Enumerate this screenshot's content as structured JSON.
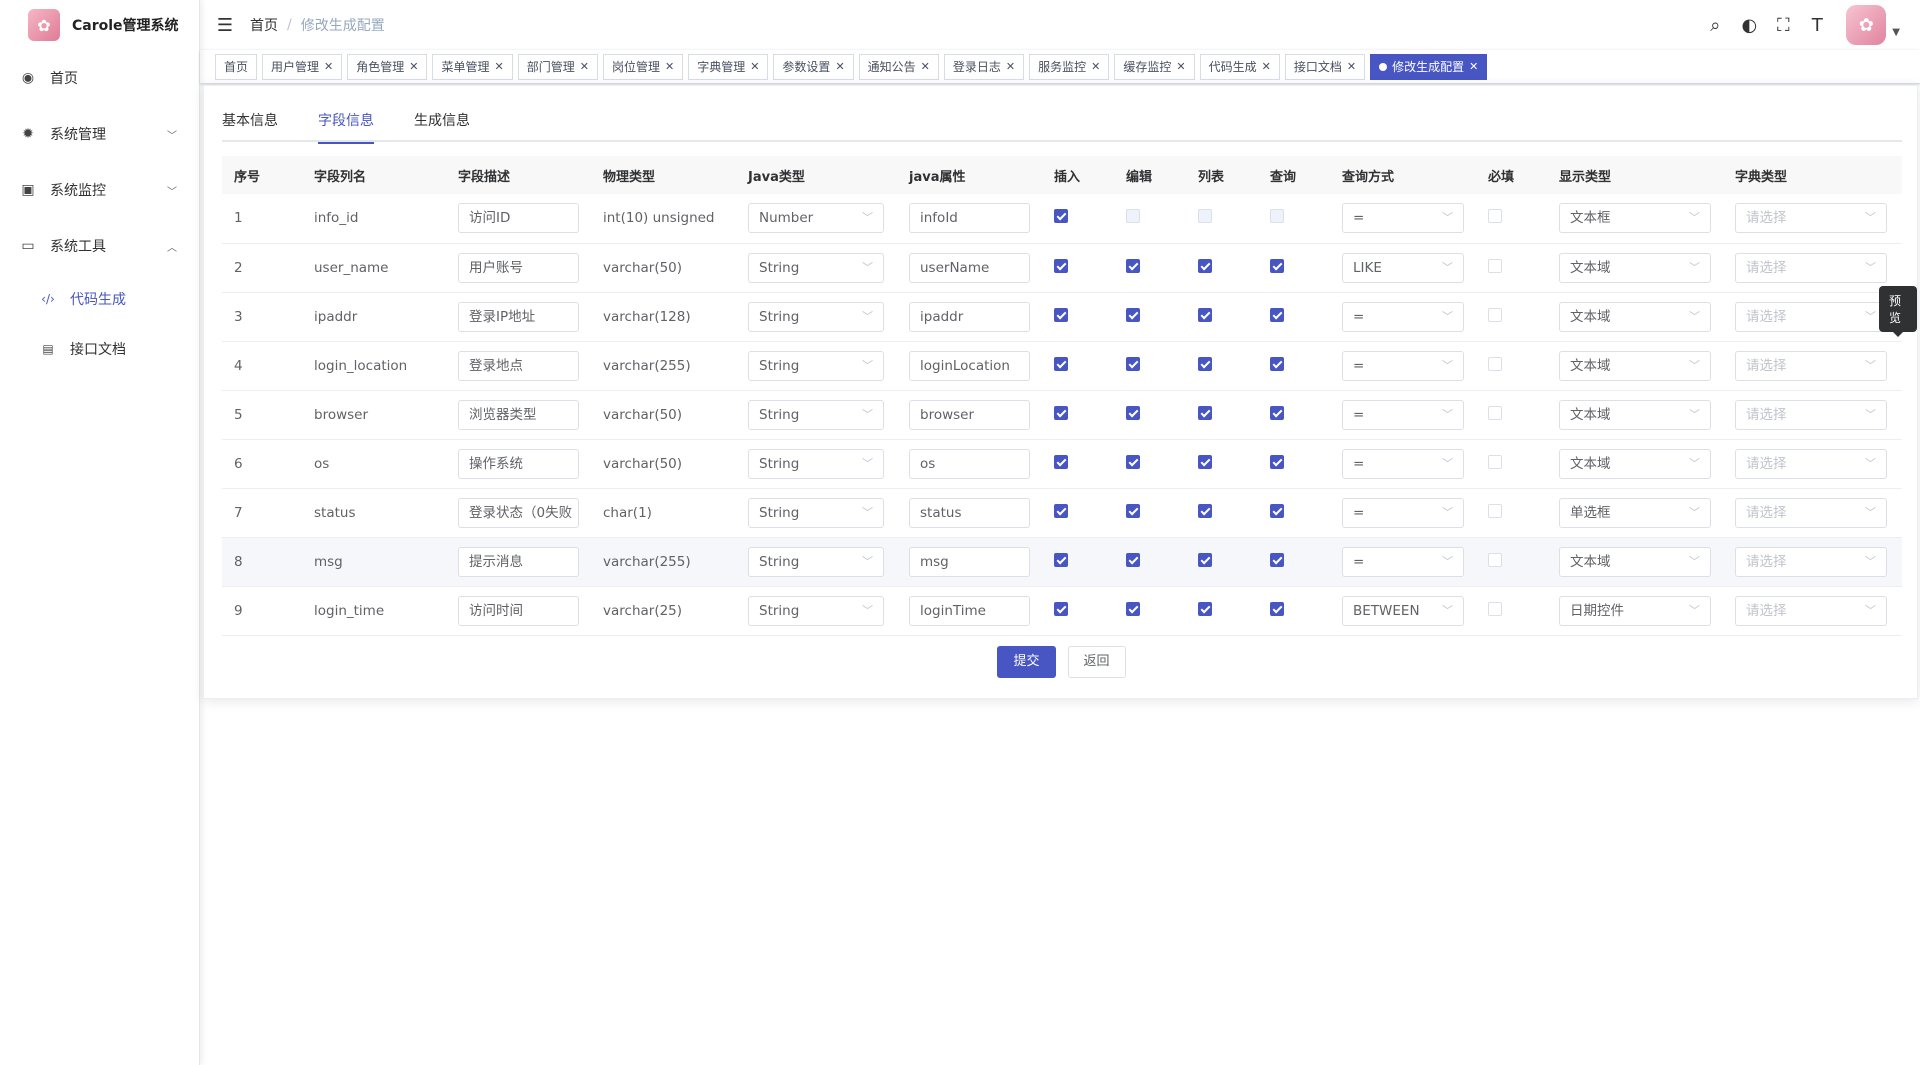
{
  "app": {
    "title": "Carole管理系统"
  },
  "sidebar": {
    "items": [
      {
        "label": "首页",
        "icon": "dashboard-icon"
      },
      {
        "label": "系统管理",
        "icon": "gear-icon"
      },
      {
        "label": "系统监控",
        "icon": "monitor-icon"
      },
      {
        "label": "系统工具",
        "icon": "toolbox-icon"
      }
    ],
    "subitems": [
      {
        "label": "代码生成",
        "icon": "code-icon"
      },
      {
        "label": "接口文档",
        "icon": "document-icon"
      }
    ]
  },
  "breadcrumb": {
    "home": "首页",
    "current": "修改生成配置"
  },
  "tags": [
    "首页",
    "用户管理",
    "角色管理",
    "菜单管理",
    "部门管理",
    "岗位管理",
    "字典管理",
    "参数设置",
    "通知公告",
    "登录日志",
    "服务监控",
    "缓存监控",
    "代码生成",
    "接口文档"
  ],
  "active_tag": "修改生成配置",
  "tabs": [
    "基本信息",
    "字段信息",
    "生成信息"
  ],
  "columns": [
    "序号",
    "字段列名",
    "字段描述",
    "物理类型",
    "Java类型",
    "java属性",
    "插入",
    "编辑",
    "列表",
    "查询",
    "查询方式",
    "必填",
    "显示类型",
    "字典类型"
  ],
  "rows": [
    {
      "no": "1",
      "column": "info_id",
      "desc": "访问ID",
      "type": "int(10) unsigned",
      "java": "Number",
      "attr": "infoId",
      "insert": true,
      "edit": false,
      "list": false,
      "query": false,
      "query_type": "=",
      "required": false,
      "html": "文本框"
    },
    {
      "no": "2",
      "column": "user_name",
      "desc": "用户账号",
      "type": "varchar(50)",
      "java": "String",
      "attr": "userName",
      "insert": true,
      "edit": true,
      "list": true,
      "query": true,
      "query_type": "LIKE",
      "required": false,
      "html": "文本域"
    },
    {
      "no": "3",
      "column": "ipaddr",
      "desc": "登录IP地址",
      "type": "varchar(128)",
      "java": "String",
      "attr": "ipaddr",
      "insert": true,
      "edit": true,
      "list": true,
      "query": true,
      "query_type": "=",
      "required": false,
      "html": "文本域"
    },
    {
      "no": "4",
      "column": "login_location",
      "desc": "登录地点",
      "type": "varchar(255)",
      "java": "String",
      "attr": "loginLocation",
      "insert": true,
      "edit": true,
      "list": true,
      "query": true,
      "query_type": "=",
      "required": false,
      "html": "文本域"
    },
    {
      "no": "5",
      "column": "browser",
      "desc": "浏览器类型",
      "type": "varchar(50)",
      "java": "String",
      "attr": "browser",
      "insert": true,
      "edit": true,
      "list": true,
      "query": true,
      "query_type": "=",
      "required": false,
      "html": "文本域"
    },
    {
      "no": "6",
      "column": "os",
      "desc": "操作系统",
      "type": "varchar(50)",
      "java": "String",
      "attr": "os",
      "insert": true,
      "edit": true,
      "list": true,
      "query": true,
      "query_type": "=",
      "required": false,
      "html": "文本域"
    },
    {
      "no": "7",
      "column": "status",
      "desc": "登录状态（0失败",
      "type": "char(1)",
      "java": "String",
      "attr": "status",
      "insert": true,
      "edit": true,
      "list": true,
      "query": true,
      "query_type": "=",
      "required": false,
      "html": "单选框"
    },
    {
      "no": "8",
      "column": "msg",
      "desc": "提示消息",
      "type": "varchar(255)",
      "java": "String",
      "attr": "msg",
      "insert": true,
      "edit": true,
      "list": true,
      "query": true,
      "query_type": "=",
      "required": false,
      "html": "文本域"
    },
    {
      "no": "9",
      "column": "login_time",
      "desc": "访问时间",
      "type": "varchar(25)",
      "java": "String",
      "attr": "loginTime",
      "insert": true,
      "edit": true,
      "list": true,
      "query": true,
      "query_type": "BETWEEN",
      "required": false,
      "html": "日期控件"
    }
  ],
  "dict_placeholder": "请选择",
  "tooltip": "预览",
  "buttons": {
    "submit": "提交",
    "back": "返回"
  },
  "colors": {
    "primary": "#4756c2"
  }
}
